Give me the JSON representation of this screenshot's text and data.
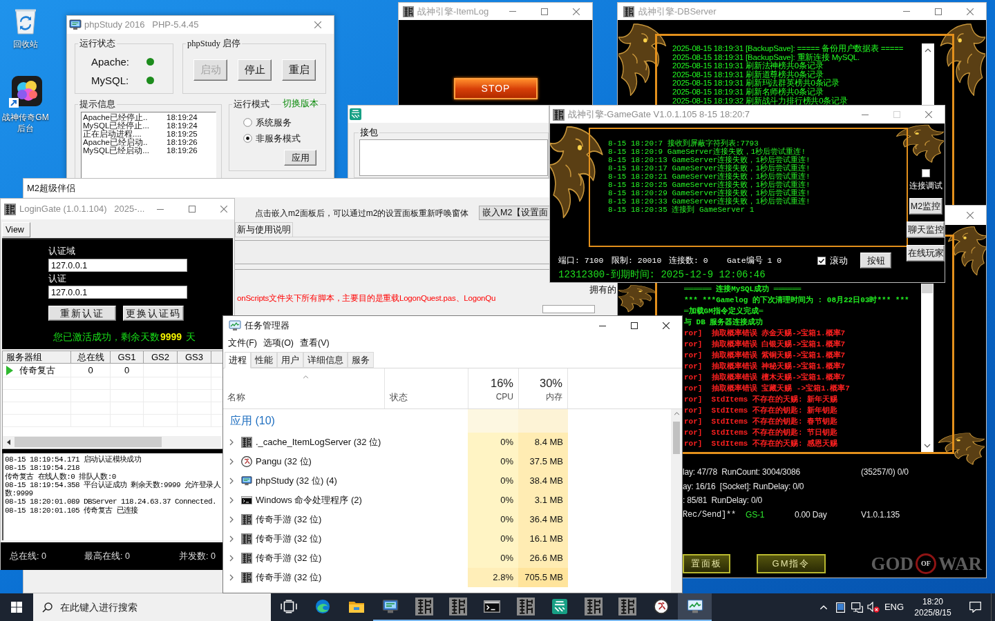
{
  "desktop_icons": [
    {
      "label": "回收站",
      "kind": "recycle_bin"
    },
    {
      "label": "战神传奇GM后台",
      "kind": "app_shortcut"
    }
  ],
  "phpstudy": {
    "title": "phpStudy 2016   PHP-5.4.45",
    "status_group": "运行状态",
    "services": [
      {
        "name": "Apache:",
        "on": true
      },
      {
        "name": "MySQL:",
        "on": true
      }
    ],
    "control_group": "phpStudy 启停",
    "buttons": [
      {
        "label": "启动",
        "disabled": true
      },
      {
        "label": "停止",
        "disabled": false
      },
      {
        "label": "重启",
        "disabled": false
      }
    ],
    "log_group": "提示信息",
    "log": [
      {
        "text": "Apache已经停止..",
        "time": "18:19:24"
      },
      {
        "text": "MySQL已经停止...",
        "time": "18:19:24"
      },
      {
        "text": "正在启动进程....",
        "time": "18:19:25"
      },
      {
        "text": "Apache已经启动..",
        "time": "18:19:26"
      },
      {
        "text": "MySQL已经启动...",
        "time": "18:19:26"
      }
    ],
    "mode_group": "运行模式",
    "switch_link": "切换版本",
    "modes": [
      {
        "label": "系统服务",
        "selected": false
      },
      {
        "label": "非服务模式",
        "selected": true
      }
    ],
    "apply_button": "应用"
  },
  "item_log": {
    "title": "战神引擎-ItemLog",
    "stop_button": "STOP"
  },
  "db_server": {
    "title": "战神引擎-DBServer",
    "log": [
      "2025-08-15 18:19:31 [BackupSave]: ===== 备份用户数据表 =====",
      "2025-08-15 18:19:31 [BackupSave]: 重新连接 MySQL.",
      "2025-08-15 18:19:31 刷新法神榜共0条记录",
      "2025-08-15 18:19:31 刷新道尊榜共0条记录",
      "2025-08-15 18:19:31 刷新玛法群英榜共0条记录",
      "2025-08-15 18:19:31 刷新名师榜共0条记录",
      "2025-08-15 18:19:32 刷新战斗力排行榜共0条记录"
    ]
  },
  "packet_window": {
    "group": "接包"
  },
  "m2_companion": {
    "title": "M2超级伴侣",
    "hint": "点击嵌入m2面板后，可以通过m2的设置面板重新呼唤窗体",
    "embed_button": "嵌入M2【设置面",
    "tab": "新与使用说明",
    "notice": "onScripts文件夹下所有脚本，主要目的是重载LogonQuest.pas、LogonQu",
    "side_label": "拥有的"
  },
  "m2_server": {
    "log": [
      {
        "text": "══════ 连接MySQL成功 ══════",
        "kind": "info"
      },
      {
        "text": "*** ***Gamelog 的下次清理时间为 : 08月22日03时*** ***",
        "kind": "info"
      },
      {
        "text": "═加载GM指令定义完成═",
        "kind": "info"
      },
      {
        "text": "与 DB 服务器连接成功",
        "kind": "info"
      },
      {
        "text": "ror]  抽取概率错误 赤金天赐->宝箱1.概率7",
        "kind": "error"
      },
      {
        "text": "ror]  抽取概率错误 白银天赐->宝箱1.概率7",
        "kind": "error"
      },
      {
        "text": "ror]  抽取概率错误 紫铜天赐->宝箱1.概率7",
        "kind": "error"
      },
      {
        "text": "ror]  抽取概率错误 神秘天赐->宝箱1.概率7",
        "kind": "error"
      },
      {
        "text": "ror]  抽取概率错误 檀木天赐->宝箱1.概率7",
        "kind": "error"
      },
      {
        "text": "ror]  抽取概率错误 宝藏天赐 ->宝箱1.概率7",
        "kind": "error"
      },
      {
        "text": "ror]  StdItems 不存在的天赐: 新年天赐",
        "kind": "error"
      },
      {
        "text": "ror]  StdItems 不存在的钥匙: 新年钥匙",
        "kind": "error"
      },
      {
        "text": "ror]  StdItems 不存在的钥匙: 春节钥匙",
        "kind": "error"
      },
      {
        "text": "ror]  StdItems 不存在的钥匙: 节日钥匙",
        "kind": "error"
      },
      {
        "text": "ror]  StdItems 不存在的天赐: 感恩天赐",
        "kind": "error"
      }
    ],
    "stats": [
      [
        "lay: 47/78  RunCount: 3004/3086",
        "(35257/0) 0/0"
      ],
      [
        "ay: 16/16  [Socket]: RunDelay: 0/0"
      ],
      [
        ": 85/81  RunDelay: 0/0"
      ]
    ],
    "footer": {
      "traffic": "Rec/Send]**",
      "gate": "GS-1",
      "days": "0.00 Day",
      "version": "V1.0.1.135"
    },
    "buttons": [
      "置面板",
      "GM指令"
    ],
    "logo": [
      "GOD",
      "OF",
      "WAR"
    ]
  },
  "login_gate": {
    "title": "LoginGate (1.0.1.104)   2025-...",
    "menu": [
      "View"
    ],
    "domain_label": "认证域",
    "domain": "127.0.0.1",
    "code_label": "认证",
    "code": "127.0.0.1",
    "buttons": [
      "重新认证",
      "更换认证码"
    ],
    "activation": {
      "message": "您已激活成功，剩余天数",
      "days": "9999",
      "unit": "天"
    },
    "table": {
      "columns": [
        "服务器组",
        "总在线",
        "GS1",
        "GS2",
        "GS3"
      ],
      "rows": [
        [
          "传奇复古",
          "0",
          "0"
        ]
      ]
    },
    "log": [
      "08-15 18:19:54.171 启动认证模块成功",
      "08-15 18:19:54.218",
      "传奇复古 在线人数:0 排队人数:0",
      "08-15 18:19:54.358 平台认证成功 剩余天数:9999 允许登录人数:9999",
      "08-15 18:20:01.089 DBServer 118.24.63.37 Connected.",
      "08-15 18:20:01.105 传奇复古 已连接"
    ],
    "status": [
      "总在线: 0",
      "最高在线: 0",
      "并发数: 0"
    ]
  },
  "game_gate": {
    "title": "战神引擎-GameGate V1.0.1.105 8-15 18:20:7",
    "maximize_disabled": true,
    "log": [
      "8-15 18:20:7 接收到屏蔽字符列表:7793",
      "8-15 18:20:9 GameServer连接失败，1秒后尝试重连!",
      "8-15 18:20:13 GameServer连接失败，1秒后尝试重连!",
      "8-15 18:20:17 GameServer连接失败，1秒后尝试重连!",
      "8-15 18:20:21 GameServer连接失败，1秒后尝试重连!",
      "8-15 18:20:25 GameServer连接失败，1秒后尝试重连!",
      "8-15 18:20:29 GameServer连接失败，1秒后尝试重连!",
      "8-15 18:20:33 GameServer连接失败，1秒后尝试重连!",
      "8-15 18:20:35 连接到 GameServer 1"
    ],
    "debug_checkbox": {
      "label": "连接调试",
      "checked": false
    },
    "side_buttons": [
      "M2监控",
      "聊天监控",
      "在线玩家"
    ],
    "status": [
      "端口: 7100",
      "限制: 20010",
      "连接数: 0",
      "Gate编号 1 0"
    ],
    "scroll_checkbox": {
      "label": "滚动",
      "checked": true
    },
    "action_button": "按钮",
    "expiry": "12312300-到期时间: 2025-12-9 12:06:46"
  },
  "task_manager": {
    "title": "任务管理器",
    "menu": [
      "文件(F)",
      "选项(O)",
      "查看(V)"
    ],
    "tabs": [
      {
        "label": "进程",
        "selected": true
      },
      {
        "label": "性能",
        "selected": false
      },
      {
        "label": "用户",
        "selected": false
      },
      {
        "label": "详细信息",
        "selected": false
      },
      {
        "label": "服务",
        "selected": false
      }
    ],
    "columns": {
      "name": "名称",
      "status": "状态",
      "cpu_total": "16%",
      "cpu": "CPU",
      "memory_total": "30%",
      "memory": "内存"
    },
    "group": "应用 (10)",
    "rows": [
      {
        "kind": "glyph",
        "name": "._cache_ItemLogServer (32 位)",
        "cpu": {
          "text": "0%",
          "color": "#fff4c4"
        },
        "memory": {
          "text": "8.4 MB",
          "color": "#ffecb3"
        }
      },
      {
        "kind": "pangu",
        "name": "Pangu (32 位)",
        "cpu": {
          "text": "0%",
          "color": "#fff4c4"
        },
        "memory": {
          "text": "37.5 MB",
          "color": "#ffecb3"
        }
      },
      {
        "kind": "phpstudy",
        "name": "phpStudy (32 位) (4)",
        "cpu": {
          "text": "0%",
          "color": "#fff4c4"
        },
        "memory": {
          "text": "38.4 MB",
          "color": "#ffecb3"
        }
      },
      {
        "kind": "terminal",
        "name": "Windows 命令处理程序 (2)",
        "cpu": {
          "text": "0%",
          "color": "#fff4c4"
        },
        "memory": {
          "text": "3.1 MB",
          "color": "#ffecb3"
        }
      },
      {
        "kind": "glyph",
        "name": "传奇手游 (32 位)",
        "cpu": {
          "text": "0%",
          "color": "#fff4c4"
        },
        "memory": {
          "text": "36.4 MB",
          "color": "#ffecb3"
        }
      },
      {
        "kind": "glyph",
        "name": "传奇手游 (32 位)",
        "cpu": {
          "text": "0%",
          "color": "#fff4c4"
        },
        "memory": {
          "text": "16.1 MB",
          "color": "#ffecb3"
        }
      },
      {
        "kind": "glyph",
        "name": "传奇手游 (32 位)",
        "cpu": {
          "text": "0%",
          "color": "#fff4c4"
        },
        "memory": {
          "text": "26.6 MB",
          "color": "#ffecb3"
        }
      },
      {
        "kind": "glyph",
        "name": "传奇手游 (32 位)",
        "cpu": {
          "text": "2.8%",
          "color": "#ffeeb8"
        },
        "memory": {
          "text": "705.5 MB",
          "color": "#ffe49c"
        }
      }
    ]
  },
  "taskbar": {
    "search": {
      "placeholder": "在此键入进行搜索"
    },
    "apps": [
      {
        "kind": "task_view",
        "running": false,
        "active": false
      },
      {
        "kind": "edge",
        "running": false,
        "active": false
      },
      {
        "kind": "explorer",
        "running": false,
        "active": false
      },
      {
        "kind": "phpstudy",
        "running": true,
        "active": false
      },
      {
        "kind": "glyph",
        "running": true,
        "active": false
      },
      {
        "kind": "glyph",
        "running": true,
        "active": false
      },
      {
        "kind": "terminal",
        "running": true,
        "active": false
      },
      {
        "kind": "glyph",
        "running": true,
        "active": false
      },
      {
        "kind": "easy",
        "running": true,
        "active": false
      },
      {
        "kind": "glyph",
        "running": true,
        "active": false
      },
      {
        "kind": "glyph",
        "running": true,
        "active": false
      },
      {
        "kind": "pangu",
        "running": true,
        "active": false
      },
      {
        "kind": "task_manager",
        "running": true,
        "active": true
      }
    ],
    "tray": {
      "language": "ENG",
      "time": "18:20",
      "date": "2025/8/15"
    }
  }
}
